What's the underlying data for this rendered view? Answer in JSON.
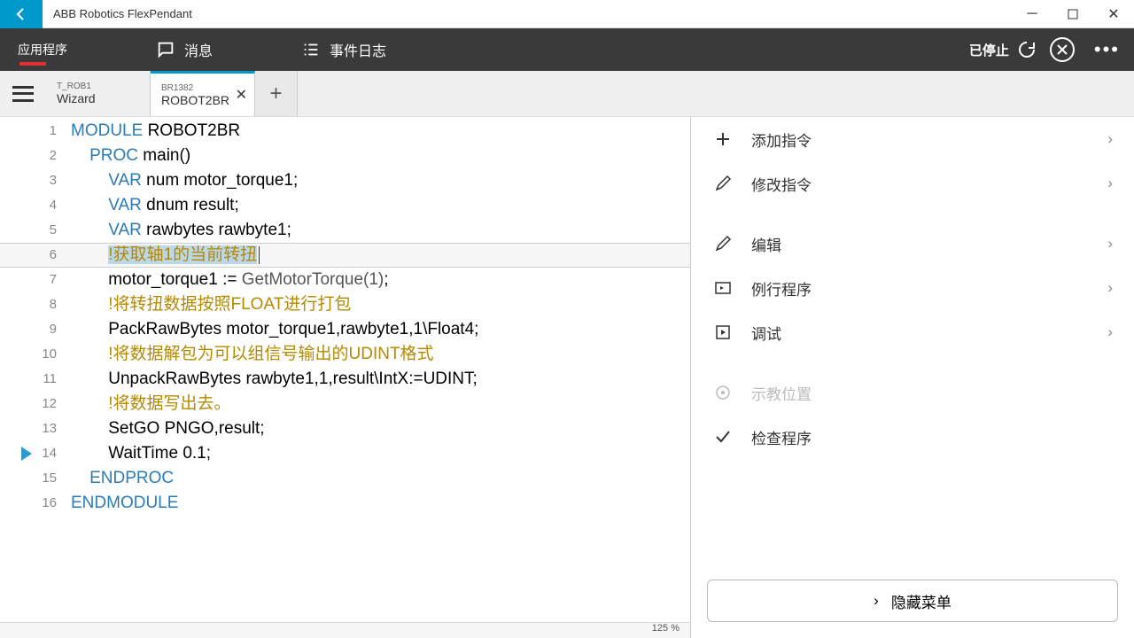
{
  "titlebar": {
    "title": "ABB Robotics FlexPendant"
  },
  "topbar": {
    "app": "应用程序",
    "messages": "消息",
    "eventlog": "事件日志",
    "status": "已停止"
  },
  "tabs": {
    "t0": {
      "small": "T_ROB1",
      "main": "Wizard"
    },
    "t1": {
      "small": "BR1382",
      "main": "ROBOT2BR"
    }
  },
  "gutter": {
    "l1": "1",
    "l2": "2",
    "l3": "3",
    "l4": "4",
    "l5": "5",
    "l6": "6",
    "l7": "7",
    "l8": "8",
    "l9": "9",
    "l10": "10",
    "l11": "11",
    "l12": "12",
    "l13": "13",
    "l14": "14",
    "l15": "15",
    "l16": "16"
  },
  "code": {
    "l1a": "MODULE",
    "l1b": " ROBOT2BR",
    "l2a": "    ",
    "l2b": "PROC",
    "l2c": " main()",
    "l3a": "        ",
    "l3b": "VAR",
    "l3c": " num motor_torque1;",
    "l4a": "        ",
    "l4b": "VAR",
    "l4c": " dnum result;",
    "l5a": "        ",
    "l5b": "VAR",
    "l5c": " rawbytes rawbyte1;",
    "l6a": "        ",
    "l6sel": "!获取轴1的当前转扭",
    "l7a": "        motor_torque1 := ",
    "l7b": "GetMotorTorque(1)",
    "l7c": ";",
    "l8a": "        ",
    "l8b": "!将转扭数据按照FLOAT进行打包",
    "l9": "        PackRawBytes motor_torque1,rawbyte1,1\\Float4;",
    "l10a": "        ",
    "l10b": "!将数据解包为可以组信号输出的UDINT格式",
    "l11": "        UnpackRawBytes rawbyte1,1,result\\IntX:=UDINT;",
    "l12a": "        ",
    "l12b": "!将数据写出去。",
    "l13": "        SetGO PNGO,result;",
    "l14": "        WaitTime 0.1;",
    "l15a": "    ",
    "l15b": "ENDPROC",
    "l16": "ENDMODULE"
  },
  "zoom": "125 %",
  "sidepanel": {
    "add": "添加指令",
    "modify": "修改指令",
    "edit": "编辑",
    "routines": "例行程序",
    "debug": "调试",
    "teach": "示教位置",
    "check": "检查程序",
    "hide": "隐藏菜单"
  }
}
